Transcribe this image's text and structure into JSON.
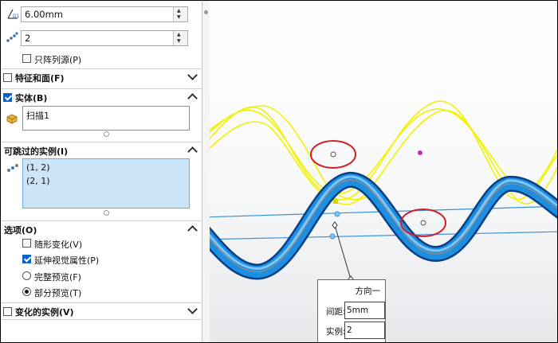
{
  "panel": {
    "distance": {
      "value": "6.00mm",
      "icon": "distance-icon"
    },
    "instances": {
      "value": "2",
      "icon": "instances-icon"
    },
    "pattern_seed_only": {
      "label": "只阵列源(P)",
      "checked": false
    },
    "features_faces": {
      "label": "特征和面(F)",
      "checked": false,
      "expanded": false
    },
    "bodies": {
      "label": "实体(B)",
      "checked": true,
      "expanded": true,
      "items": [
        "扫描1"
      ]
    },
    "skip_instances": {
      "label": "可跳过的实例(I)",
      "expanded": true,
      "items": [
        "(1, 2)",
        "(2, 1)"
      ]
    },
    "options": {
      "label": "选项(O)",
      "expanded": true,
      "vary_sketch": {
        "label": "随形变化(V)",
        "checked": false
      },
      "propagate_visual": {
        "label": "延伸视觉属性(P)",
        "checked": true
      },
      "full_preview": {
        "label": "完整预览(F)",
        "selected": false
      },
      "partial_preview": {
        "label": "部分预览(T)",
        "selected": true
      }
    },
    "varied_instances": {
      "label": "变化的实例(V)",
      "checked": false,
      "expanded": false
    }
  },
  "callout": {
    "title": "方向一",
    "spacing_label": "间距:",
    "spacing_value": "5mm",
    "instances_label": "实例:",
    "instances_value": "2"
  },
  "colors": {
    "accent": "#0b63c6",
    "selection_bg": "#cce4f7",
    "body_blue": "#1e8fe0",
    "curve_yellow": "#f2f200",
    "mark_red": "#d2202a",
    "plane_line": "#3b8fd8"
  }
}
